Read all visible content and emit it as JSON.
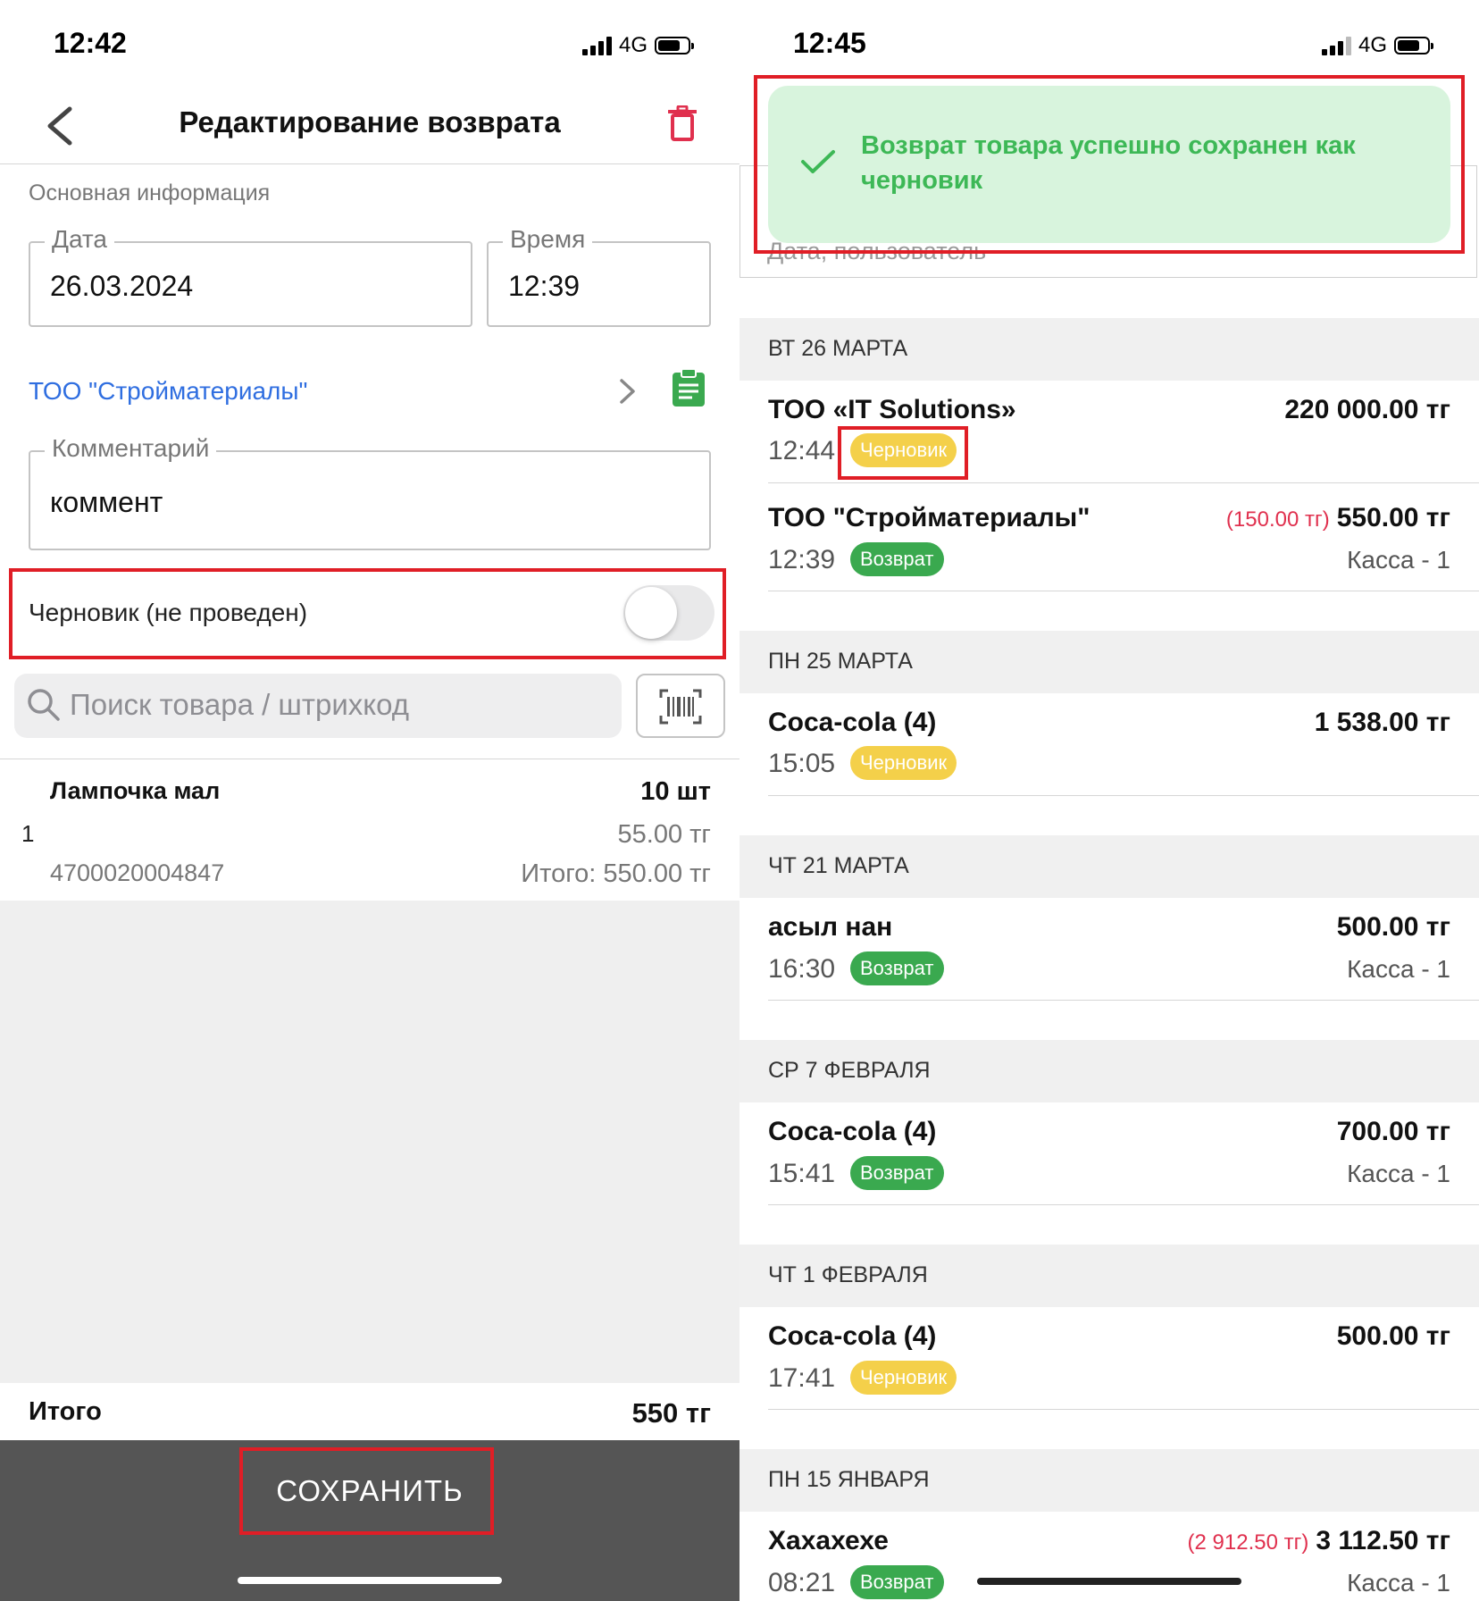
{
  "left": {
    "status": {
      "time": "12:42",
      "network": "4G"
    },
    "header": {
      "title": "Редактирование возврата"
    },
    "section_label": "Основная информация",
    "date_field": {
      "label": "Дата",
      "value": "26.03.2024"
    },
    "time_field": {
      "label": "Время",
      "value": "12:39"
    },
    "supplier": "ТОО \"Стройматериалы\"",
    "comment_field": {
      "label": "Комментарий",
      "value": "коммент"
    },
    "draft_toggle": {
      "label": "Черновик (не проведен)",
      "on": false
    },
    "search": {
      "placeholder": "Поиск товара / штрихкод"
    },
    "item": {
      "index": "1",
      "name": "Лампочка мал",
      "qty": "10 шт",
      "price": "55.00 тг",
      "barcode": "4700020004847",
      "subtotal": "Итого: 550.00 тг"
    },
    "total": {
      "label": "Итого",
      "value": "550 тг"
    },
    "save_label": "СОХРАНИТЬ"
  },
  "right": {
    "status": {
      "time": "12:45",
      "network": "4G"
    },
    "toast": {
      "message": "Возврат товара успешно сохранен как черновик"
    },
    "filter_placeholder": "Дата, пользователь",
    "groups": [
      {
        "header": "ВТ 26 МАРТА",
        "rows": [
          {
            "title": "ТОО «IT Solutions»",
            "amount": "220 000.00 тг",
            "time": "12:44",
            "badge": "Черновик",
            "status": "draft"
          },
          {
            "title": "ТОО \"Стройматериалы\"",
            "amount_paren": "(150.00 тг)",
            "amount": "550.00 тг",
            "time": "12:39",
            "badge": "Возврат",
            "status": "return",
            "sub": "Касса - 1"
          }
        ]
      },
      {
        "header": "ПН 25 МАРТА",
        "rows": [
          {
            "title": "Coca-cola (4)",
            "amount": "1 538.00 тг",
            "time": "15:05",
            "badge": "Черновик",
            "status": "draft"
          }
        ]
      },
      {
        "header": "ЧТ 21 МАРТА",
        "rows": [
          {
            "title": "асыл нан",
            "amount": "500.00 тг",
            "time": "16:30",
            "badge": "Возврат",
            "status": "return",
            "sub": "Касса - 1"
          }
        ]
      },
      {
        "header": "СР 7 ФЕВРАЛЯ",
        "rows": [
          {
            "title": "Coca-cola (4)",
            "amount": "700.00 тг",
            "time": "15:41",
            "badge": "Возврат",
            "status": "return",
            "sub": "Касса - 1"
          }
        ]
      },
      {
        "header": "ЧТ 1 ФЕВРАЛЯ",
        "rows": [
          {
            "title": "Coca-cola (4)",
            "amount": "500.00 тг",
            "time": "17:41",
            "badge": "Черновик",
            "status": "draft"
          }
        ]
      },
      {
        "header": "ПН 15 ЯНВАРЯ",
        "rows": [
          {
            "title": "Хахахехе",
            "amount_paren": "(2 912.50 тг)",
            "amount": "3 112.50 тг",
            "time": "08:21",
            "badge": "Возврат",
            "status": "return",
            "sub": "Касса - 1"
          }
        ]
      }
    ]
  },
  "colors": {
    "accent_blue": "#2f6ee0",
    "delete_red": "#e0304e",
    "success_green": "#3db856",
    "toast_bg": "#d8f4dd",
    "draft_badge": "#f4d04a",
    "return_badge": "#3aa94f",
    "highlight_red": "#e01e26",
    "bottom_bar": "#555555"
  }
}
